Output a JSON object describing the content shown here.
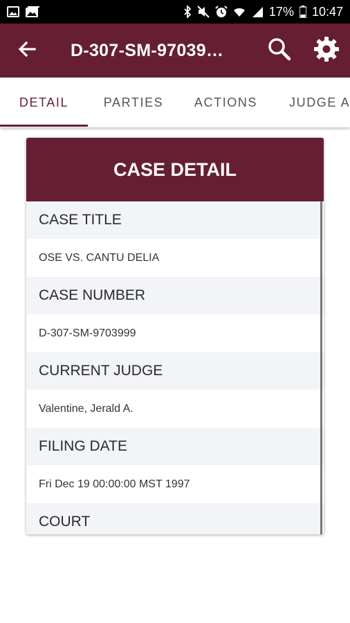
{
  "status_bar": {
    "battery": "17%",
    "time": "10:47",
    "left_icons": [
      "image-icon",
      "gallery-icon"
    ],
    "right_icons": [
      "bluetooth-icon",
      "mute-icon",
      "alarm-icon",
      "wifi-icon",
      "signal-icon",
      "battery-icon"
    ]
  },
  "appbar": {
    "title": "D-307-SM-97039…",
    "back_icon": "arrow-back-icon",
    "search_icon": "search-icon",
    "settings_icon": "gear-icon",
    "color": "#661f32"
  },
  "tabs": [
    {
      "label": "DETAIL",
      "active": true
    },
    {
      "label": "PARTIES",
      "active": false
    },
    {
      "label": "ACTIONS",
      "active": false
    },
    {
      "label": "JUDGE A",
      "active": false
    }
  ],
  "card": {
    "title": "CASE DETAIL",
    "rows": [
      {
        "label": "CASE TITLE",
        "value": "OSE VS. CANTU DELIA"
      },
      {
        "label": "CASE NUMBER",
        "value": "D-307-SM-9703999"
      },
      {
        "label": "CURRENT JUDGE",
        "value": "Valentine, Jerald A."
      },
      {
        "label": "FILING DATE",
        "value": "Fri Dec 19 00:00:00 MST 1997"
      },
      {
        "label": "COURT",
        "value": ""
      }
    ]
  }
}
